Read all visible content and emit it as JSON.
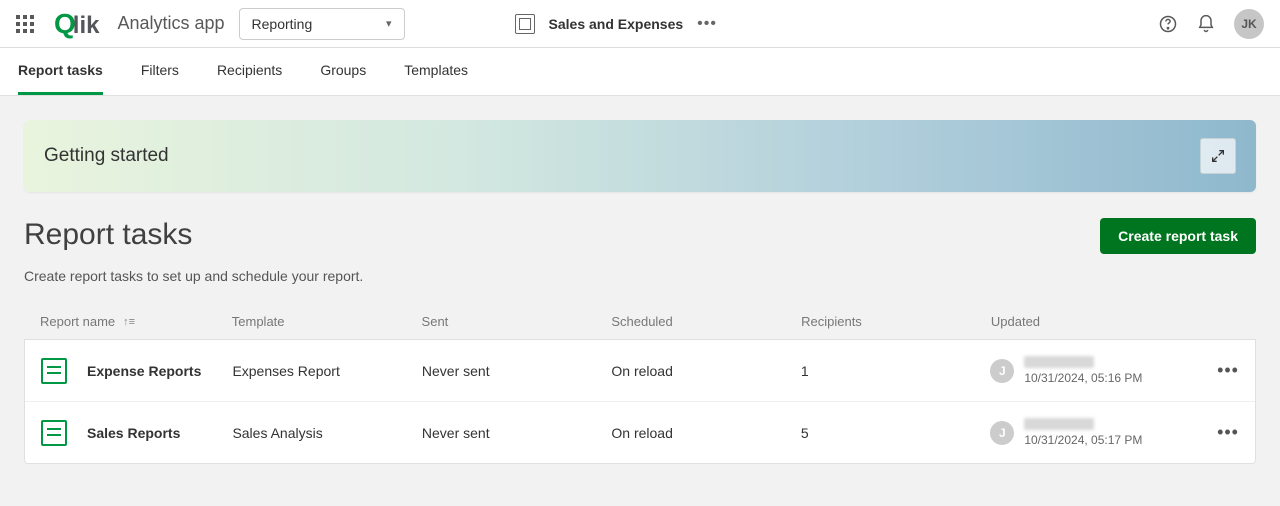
{
  "header": {
    "app_name": "Analytics app",
    "dropdown_value": "Reporting",
    "sheet_name": "Sales and Expenses",
    "avatar_initials": "JK"
  },
  "tabs": [
    {
      "id": "report-tasks",
      "label": "Report tasks",
      "active": true
    },
    {
      "id": "filters",
      "label": "Filters",
      "active": false
    },
    {
      "id": "recipients",
      "label": "Recipients",
      "active": false
    },
    {
      "id": "groups",
      "label": "Groups",
      "active": false
    },
    {
      "id": "templates",
      "label": "Templates",
      "active": false
    }
  ],
  "banner": {
    "title": "Getting started"
  },
  "section": {
    "title": "Report tasks",
    "subtitle": "Create report tasks to set up and schedule your report.",
    "create_label": "Create report task"
  },
  "columns": {
    "name": "Report name",
    "template": "Template",
    "sent": "Sent",
    "scheduled": "Scheduled",
    "recipients": "Recipients",
    "updated": "Updated"
  },
  "rows": [
    {
      "name": "Expense Reports",
      "template": "Expenses Report",
      "sent": "Never sent",
      "scheduled": "On reload",
      "recipients": "1",
      "updated_initial": "J",
      "updated_time": "10/31/2024, 05:16 PM"
    },
    {
      "name": "Sales Reports",
      "template": "Sales Analysis",
      "sent": "Never sent",
      "scheduled": "On reload",
      "recipients": "5",
      "updated_initial": "J",
      "updated_time": "10/31/2024, 05:17 PM"
    }
  ]
}
